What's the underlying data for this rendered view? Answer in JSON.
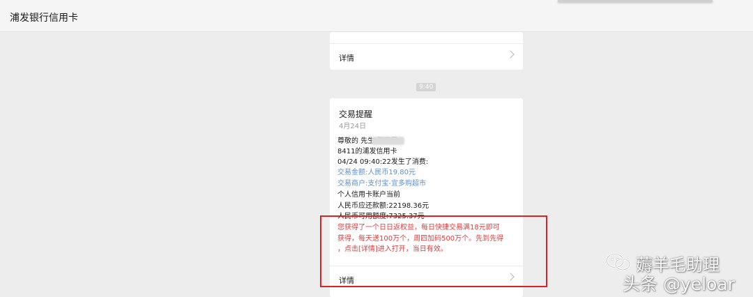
{
  "header": {
    "title": "浦发银行信用卡"
  },
  "top_card": {
    "detail_label": "详情"
  },
  "time_badge": "9:40",
  "message": {
    "title": "交易提醒",
    "date": "4月24日",
    "lines": [
      {
        "text": "尊敬的        先生,您尾号:",
        "style": "normal"
      },
      {
        "text": "8411的浦发信用卡",
        "style": "normal"
      },
      {
        "text": "04/24 09:40:22发生了消费:",
        "style": "normal"
      },
      {
        "text": "交易金额:人民币19.80元",
        "style": "blue"
      },
      {
        "text": "交易商户:支付宝-宜多购超市",
        "style": "blue"
      },
      {
        "text": "个人信用卡账户当前",
        "style": "normal"
      },
      {
        "text": "人民币应还款额:22198.36元",
        "style": "normal"
      },
      {
        "text": "人民币可用额度:7325.37元",
        "style": "normal"
      },
      {
        "text": "您获得了一个日日返权益，每日快捷交易满18元即可",
        "style": "red"
      },
      {
        "text": "获得，每天送100万个，周四加码500万个。先到先得",
        "style": "red"
      },
      {
        "text": "，点击[详情]进入打开，当日有效。",
        "style": "red"
      }
    ],
    "detail_label": "详情"
  },
  "watermarks": {
    "wechat_account": "薅羊毛助理",
    "toutiao": "头条 @yeloar"
  },
  "colors": {
    "background": "#ededed",
    "card": "#ffffff",
    "highlight_box": "#e02020",
    "link_blue": "#5b8fd0",
    "promo_red": "#e03b3b"
  }
}
